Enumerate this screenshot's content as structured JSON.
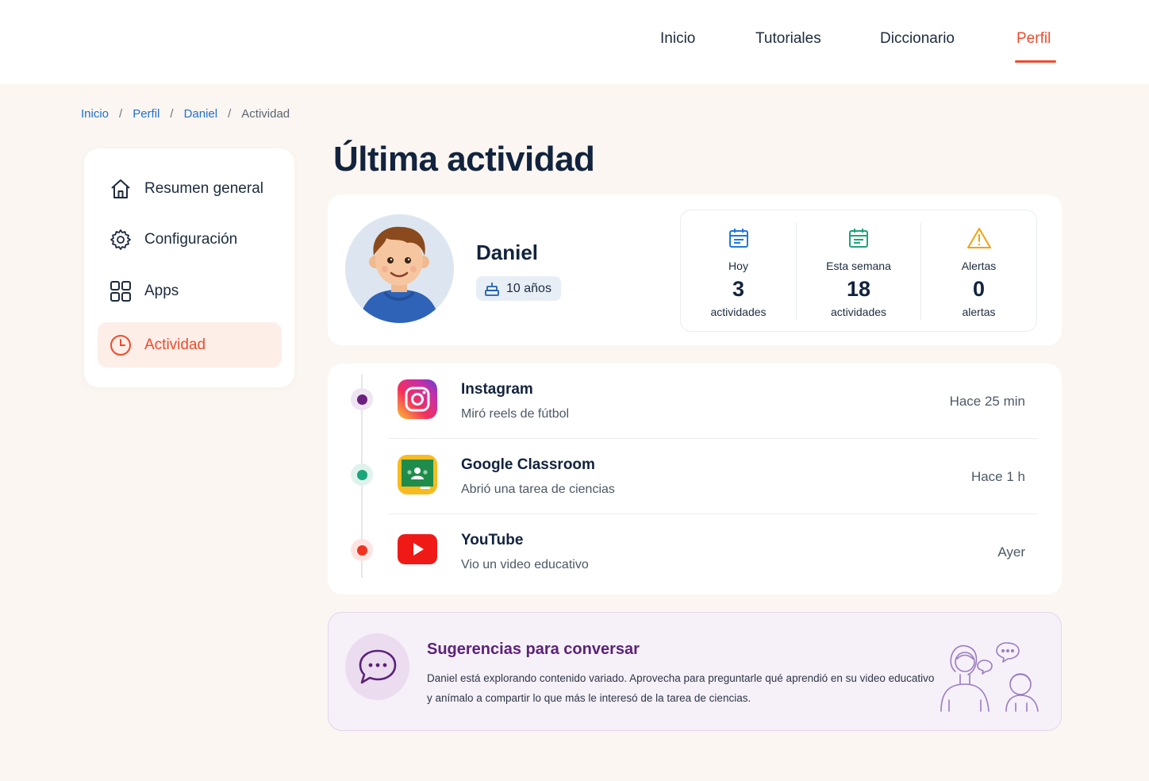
{
  "nav": {
    "items": [
      {
        "label": "Inicio",
        "active": false
      },
      {
        "label": "Tutoriales",
        "active": false
      },
      {
        "label": "Diccionario",
        "active": false
      },
      {
        "label": "Perfil",
        "active": true
      }
    ]
  },
  "breadcrumb": {
    "items": [
      "Inicio",
      "Perfil",
      "Daniel"
    ],
    "separator": "/",
    "current": "Actividad"
  },
  "sidebar": {
    "items": [
      {
        "label": "Resumen general",
        "icon": "home-icon"
      },
      {
        "label": "Configuración",
        "icon": "gear-icon"
      },
      {
        "label": "Apps",
        "icon": "apps-grid-icon"
      },
      {
        "label": "Actividad",
        "icon": "clock-icon",
        "active": true
      }
    ]
  },
  "page": {
    "title": "Última actividad"
  },
  "profile": {
    "name": "Daniel",
    "age": "10 años"
  },
  "stats": [
    {
      "label": "Hoy",
      "value": "3",
      "unit": "actividades",
      "icon": "calendar-icon",
      "color": "#1f78e0"
    },
    {
      "label": "Esta semana",
      "value": "18",
      "unit": "actividades",
      "icon": "calendar-week-icon",
      "color": "#1fa37a"
    },
    {
      "label": "Alertas",
      "value": "0",
      "unit": "alertas",
      "icon": "warning-icon",
      "color": "#f2a20c"
    }
  ],
  "timeline": [
    {
      "app": "Instagram",
      "description": "Miró reels de fútbol",
      "time": "Hace 25 min",
      "dot_color": "#6b1f7f"
    },
    {
      "app": "Google Classroom",
      "description": "Abrió una tarea de ciencias",
      "time": "Hace 1 h",
      "dot_color": "#18a67a"
    },
    {
      "app": "YouTube",
      "description": "Vio un video educativo",
      "time": "Ayer",
      "dot_color": "#f0331f"
    }
  ],
  "suggestions": {
    "title": "Sugerencias para conversar",
    "text": "Daniel está explorando contenido variado. Aprovecha para preguntarle qué aprendió en su video educativo y anímalo a compartir lo que más le interesó de la tarea de ciencias."
  },
  "colors": {
    "accent": "#ef4b2c",
    "link": "#1f6fd1",
    "purple": "#5b2378"
  }
}
